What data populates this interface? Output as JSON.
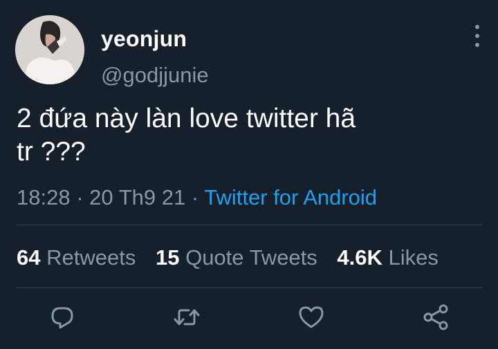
{
  "user": {
    "display_name": "yeonjun",
    "handle": "@godjjunie",
    "avatar_icon": "profile-photo"
  },
  "tweet": {
    "text_line1": "2 đứa này làn love twitter hã",
    "text_line2": "tr ???"
  },
  "meta": {
    "time": "18:28",
    "separator": "·",
    "date": "20 Th9 21",
    "source": "Twitter for Android"
  },
  "stats": {
    "retweets_count": "64",
    "retweets_label": "Retweets",
    "quotes_count": "15",
    "quotes_label": "Quote Tweets",
    "likes_count": "4.6K",
    "likes_label": "Likes"
  },
  "actions": {
    "icons": [
      "reply-icon",
      "retweet-icon",
      "like-icon",
      "share-icon"
    ]
  },
  "colors": {
    "background": "#15202b",
    "text": "#ffffff",
    "muted": "#8899a6",
    "accent": "#1da1f2",
    "divider": "#38444d"
  }
}
